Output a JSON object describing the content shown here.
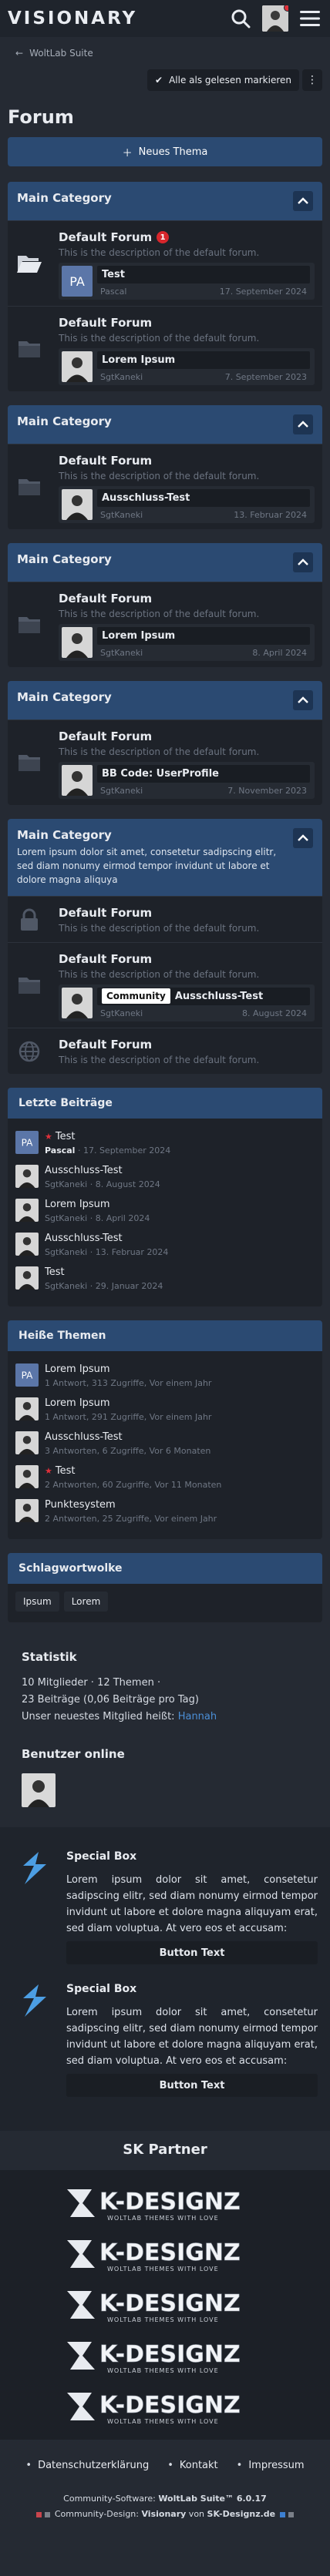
{
  "header": {
    "logo": "VISIONARY",
    "accent": "#2b4a72"
  },
  "breadcrumb": {
    "label": "WoltLab Suite"
  },
  "toolbar": {
    "mark_read": "Alle als gelesen markieren"
  },
  "page": {
    "title": "Forum",
    "new_thread": "Neues Thema"
  },
  "categories": [
    {
      "title": "Main Category",
      "description": "",
      "boards": [
        {
          "name": "Default Forum",
          "badge": "1",
          "description": "This is the description of the default forum.",
          "icon": "folder-open-icon",
          "last": {
            "title": "Test",
            "author": "Pascal",
            "date": "17. September 2024",
            "avatar": "PA"
          }
        },
        {
          "name": "Default Forum",
          "badge": "",
          "description": "This is the description of the default forum.",
          "icon": "folder-icon",
          "last": {
            "title": "Lorem Ipsum",
            "author": "SgtKaneki",
            "date": "7. September 2023",
            "avatar": "img"
          }
        }
      ]
    },
    {
      "title": "Main Category",
      "description": "",
      "boards": [
        {
          "name": "Default Forum",
          "description": "This is the description of the default forum.",
          "icon": "folder-icon",
          "last": {
            "title": "Ausschluss-Test",
            "author": "SgtKaneki",
            "date": "13. Februar 2024",
            "avatar": "img"
          }
        }
      ]
    },
    {
      "title": "Main Category",
      "description": "",
      "boards": [
        {
          "name": "Default Forum",
          "description": "This is the description of the default forum.",
          "icon": "folder-icon",
          "last": {
            "title": "Lorem Ipsum",
            "author": "SgtKaneki",
            "date": "8. April 2024",
            "avatar": "img"
          }
        }
      ]
    },
    {
      "title": "Main Category",
      "description": "",
      "boards": [
        {
          "name": "Default Forum",
          "description": "This is the description of the default forum.",
          "icon": "folder-icon",
          "last": {
            "title": "BB Code: UserProfile",
            "author": "SgtKaneki",
            "date": "7. November 2023",
            "avatar": "img"
          }
        }
      ]
    },
    {
      "title": "Main Category",
      "description": "Lorem ipsum dolor sit amet, consetetur sadipscing elitr, sed diam nonumy eirmod tempor invidunt ut labore et dolore magna aliquya",
      "boards": [
        {
          "name": "Default Forum",
          "description": "This is the description of the default forum.",
          "icon": "lock-icon"
        },
        {
          "name": "Default Forum",
          "description": "This is the description of the default forum.",
          "icon": "folder-icon",
          "last": {
            "label": "Community",
            "title": "Ausschluss-Test",
            "author": "SgtKaneki",
            "date": "8. August 2024",
            "avatar": "img"
          }
        },
        {
          "name": "Default Forum",
          "description": "This is the description of the default forum.",
          "icon": "globe-icon"
        }
      ]
    }
  ],
  "recent": {
    "title": "Letzte Beiträge",
    "items": [
      {
        "title": "Test",
        "meta": "Pascal · 17. September 2024",
        "avatar": "PA",
        "new": true,
        "author": "Pascal",
        "date": "17. September 2024"
      },
      {
        "title": "Ausschluss-Test",
        "author": "SgtKaneki",
        "date": "8. August 2024"
      },
      {
        "title": "Lorem Ipsum",
        "author": "SgtKaneki",
        "date": "8. April 2024"
      },
      {
        "title": "Ausschluss-Test",
        "author": "SgtKaneki",
        "date": "13. Februar 2024"
      },
      {
        "title": "Test",
        "author": "SgtKaneki",
        "date": "29. Januar 2024"
      }
    ]
  },
  "hot": {
    "title": "Heiße Themen",
    "items": [
      {
        "title": "Lorem Ipsum",
        "meta": "1 Antwort, 313 Zugriffe, Vor einem Jahr",
        "avatar": "PA"
      },
      {
        "title": "Lorem Ipsum",
        "meta": "1 Antwort, 291 Zugriffe, Vor einem Jahr"
      },
      {
        "title": "Ausschluss-Test",
        "meta": "3 Antworten, 6 Zugriffe, Vor 6 Monaten"
      },
      {
        "title": "Test",
        "meta": "2 Antworten, 60 Zugriffe, Vor 11 Monaten",
        "new": true
      },
      {
        "title": "Punktesystem",
        "meta": "2 Antworten, 25 Zugriffe, Vor einem Jahr"
      }
    ]
  },
  "tagcloud": {
    "title": "Schlagwortwolke",
    "tags": [
      "Ipsum",
      "Lorem"
    ]
  },
  "stats": {
    "title": "Statistik",
    "line1": "10 Mitglieder · 12 Themen ·",
    "line2": "23 Beiträge (0,06 Beiträge pro Tag)",
    "line3": "Unser neuestes Mitglied heißt:",
    "newest": "Hannah"
  },
  "online": {
    "title": "Benutzer online"
  },
  "specialboxes": [
    {
      "title": "Special Box",
      "text": "Lorem ipsum dolor sit amet, consetetur sadipscing elitr, sed diam nonumy eirmod tempor invidunt ut labore et dolore magna aliquyam erat, sed diam voluptua. At vero eos et accusam:",
      "button": "Button Text"
    },
    {
      "title": "Special Box",
      "text": "Lorem ipsum dolor sit amet, consetetur sadipscing elitr, sed diam nonumy eirmod tempor invidunt ut labore et dolore magna aliquyam erat, sed diam voluptua. At vero eos et accusam:",
      "button": "Button Text"
    }
  ],
  "partners": {
    "title": "SK Partner",
    "logo_text": "K-DESIGNZ",
    "logo_sub": "WOLTLAB THEMES WITH LOVE",
    "count": 5
  },
  "footer": {
    "links": [
      "Datenschutzerklärung",
      "Kontakt",
      "Impressum"
    ],
    "software_prefix": "Community-Software: ",
    "software": "WoltLab Suite™ 6.0.17",
    "design_prefix": "Community-Design: ",
    "design": "Visionary",
    "design_by": " von ",
    "design_author": "SK-Designz.de"
  }
}
